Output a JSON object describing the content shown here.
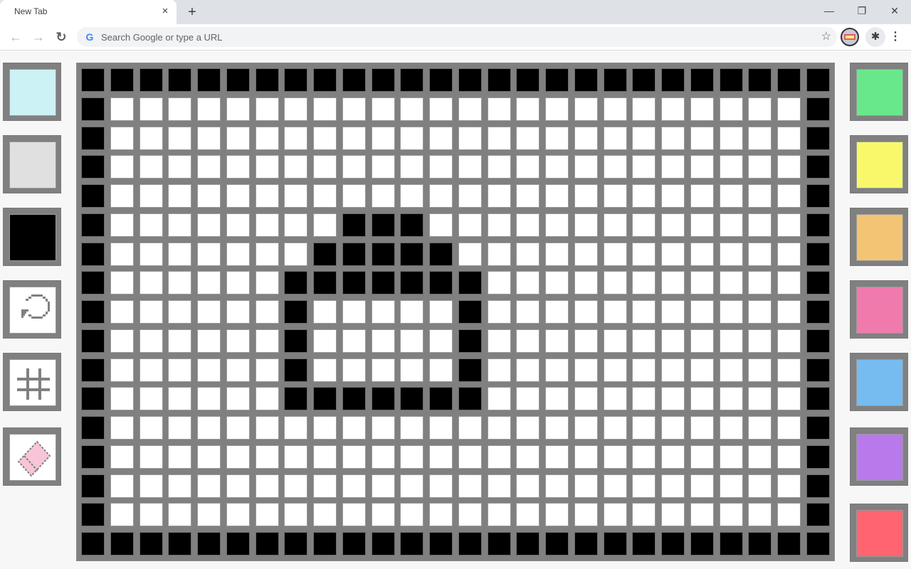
{
  "browser": {
    "tab_title": "New Tab",
    "tab_close_icon": "×",
    "new_tab_icon": "+",
    "omnibox_placeholder": "Search Google or type a URL",
    "window_controls": {
      "minimize": "—",
      "restore": "❐",
      "close": "✕"
    },
    "nav": {
      "back": "←",
      "forward": "→",
      "reload": "↻"
    },
    "bookmark_icon": "☆",
    "extensions_icon": "✱",
    "menu_icon": "⋮",
    "google_icon": "G"
  },
  "left_tools": [
    {
      "name": "color-light-cyan",
      "type": "color",
      "color": "#ccf2f6"
    },
    {
      "name": "color-light-gray",
      "type": "color",
      "color": "#e0e0e0"
    },
    {
      "name": "color-black",
      "type": "color",
      "color": "#000000"
    },
    {
      "name": "reset-button",
      "type": "icon",
      "icon": "undo-circle-icon"
    },
    {
      "name": "grid-toggle-button",
      "type": "icon",
      "icon": "grid-icon"
    },
    {
      "name": "eraser-button",
      "type": "icon",
      "icon": "eraser-icon"
    }
  ],
  "right_palette": [
    {
      "name": "color-green",
      "color": "#68e88a"
    },
    {
      "name": "color-yellow",
      "color": "#f8f86a"
    },
    {
      "name": "color-orange",
      "color": "#f2c474"
    },
    {
      "name": "color-pink",
      "color": "#f07aac"
    },
    {
      "name": "color-blue",
      "color": "#76bcf0"
    },
    {
      "name": "color-purple",
      "color": "#b87aea"
    },
    {
      "name": "color-red",
      "color": "#ff6470"
    }
  ],
  "grid": {
    "cols": 26,
    "rows": 17,
    "on_color": "#000000",
    "off_color": "#ffffff",
    "filled_cells": [
      [
        5,
        9
      ],
      [
        5,
        10
      ],
      [
        5,
        11
      ],
      [
        6,
        8
      ],
      [
        6,
        9
      ],
      [
        6,
        10
      ],
      [
        6,
        11
      ],
      [
        6,
        12
      ],
      [
        7,
        7
      ],
      [
        7,
        8
      ],
      [
        7,
        9
      ],
      [
        7,
        10
      ],
      [
        7,
        11
      ],
      [
        7,
        12
      ],
      [
        7,
        13
      ],
      [
        8,
        7
      ],
      [
        8,
        13
      ],
      [
        9,
        7
      ],
      [
        9,
        13
      ],
      [
        10,
        7
      ],
      [
        10,
        13
      ],
      [
        11,
        7
      ],
      [
        11,
        8
      ],
      [
        11,
        9
      ],
      [
        11,
        10
      ],
      [
        11,
        11
      ],
      [
        11,
        12
      ],
      [
        11,
        13
      ]
    ],
    "border_filled": true
  }
}
